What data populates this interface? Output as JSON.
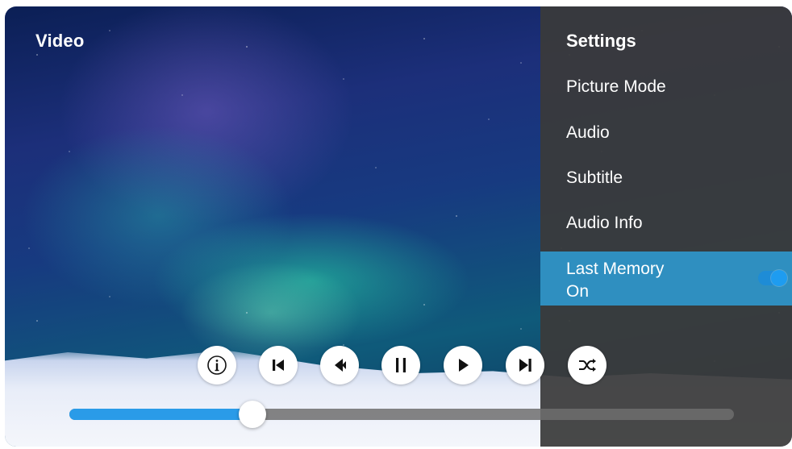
{
  "player": {
    "title": "Video"
  },
  "settings": {
    "title": "Settings",
    "items": [
      {
        "label": "Picture Mode"
      },
      {
        "label": "Audio"
      },
      {
        "label": "Subtitle"
      },
      {
        "label": "Audio Info"
      }
    ],
    "selected_item": {
      "label": "Last Memory",
      "value": "On",
      "toggle_on": true
    }
  },
  "controls": [
    {
      "icon": "info-icon"
    },
    {
      "icon": "skip-previous-icon"
    },
    {
      "icon": "rewind-icon"
    },
    {
      "icon": "pause-icon"
    },
    {
      "icon": "play-icon"
    },
    {
      "icon": "skip-next-icon"
    },
    {
      "icon": "shuffle-icon"
    }
  ],
  "progress": {
    "fraction": 0.275
  },
  "colors": {
    "accent": "#2a9be8",
    "selected_row": "#2f8fc0",
    "panel": "#3a3a3a"
  }
}
